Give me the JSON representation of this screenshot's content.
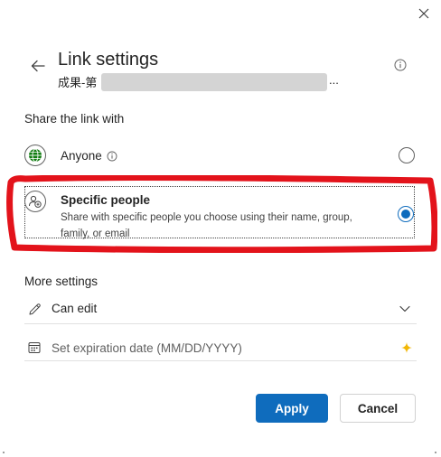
{
  "dialog": {
    "title": "Link settings",
    "file_name_prefix": "成果-第",
    "file_name_ellipsis": "..."
  },
  "share_section": {
    "label": "Share the link with",
    "options": [
      {
        "label": "Anyone",
        "icon": "globe-icon",
        "selected": false
      },
      {
        "label": "Specific people",
        "description": "Share with specific people you choose using their name, group, family, or email",
        "icon": "people-icon",
        "selected": true
      }
    ]
  },
  "more_settings": {
    "label": "More settings",
    "permission": {
      "value": "Can edit",
      "icon": "pencil-icon"
    },
    "expiration": {
      "placeholder": "Set expiration date (MM/DD/YYYY)",
      "icon": "calendar-icon"
    }
  },
  "buttons": {
    "apply": "Apply",
    "cancel": "Cancel"
  },
  "colors": {
    "accent": "#0f6cbd",
    "annotation": "#e3131b",
    "globe": "#107c10",
    "sparkle": "#f2b705"
  }
}
